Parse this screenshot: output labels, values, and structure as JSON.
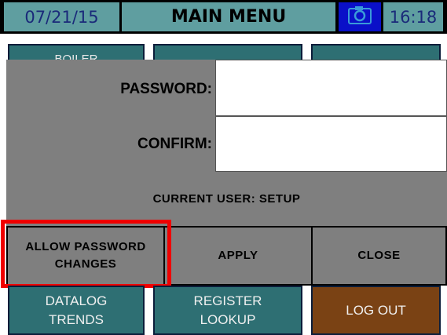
{
  "header": {
    "date": "07/21/15",
    "title": "MAIN MENU",
    "camera_icon": "camera-icon",
    "time": "16:18"
  },
  "top_buttons": [
    "BOILER",
    "",
    ""
  ],
  "dialog": {
    "password_label": "PASSWORD:",
    "password_value": "",
    "confirm_label": "CONFIRM:",
    "confirm_value": "",
    "current_user": "CURRENT USER: SETUP",
    "allow_line1": "ALLOW PASSWORD",
    "allow_line2": "CHANGES",
    "apply": "APPLY",
    "close": "CLOSE"
  },
  "bottom_buttons": {
    "datalog_line1": "DATALOG",
    "datalog_line2": "TRENDS",
    "register_line1": "REGISTER",
    "register_line2": "LOOKUP",
    "logout": "LOG OUT"
  },
  "colors": {
    "header_cell": "#5f9ea0",
    "button_teal": "#2e6f73",
    "dialog_gray": "#7f7f7f",
    "logout_brown": "#7a4214",
    "camera_blue": "#0a10c8",
    "highlight_red": "#f00000"
  }
}
